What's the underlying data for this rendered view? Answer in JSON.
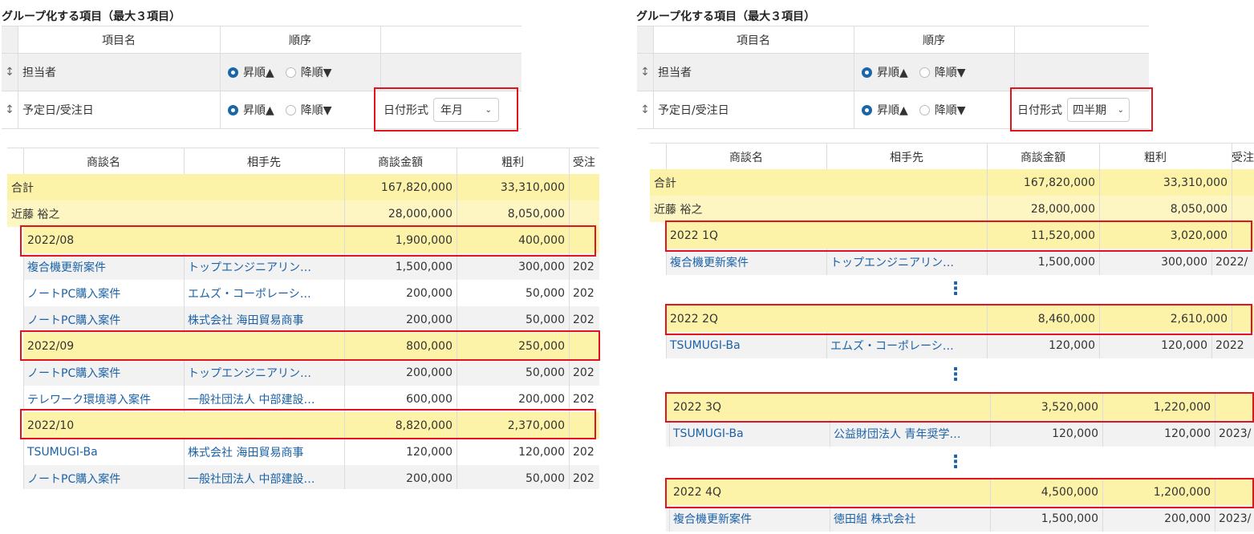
{
  "left": {
    "title": "グループ化する項目（最大３項目）",
    "cfg_headers": {
      "name": "項目名",
      "order": "順序"
    },
    "cfg_rows": [
      {
        "name": "担当者",
        "asc": "昇順▲",
        "desc": "降順▼"
      },
      {
        "name": "予定日/受注日",
        "asc": "昇順▲",
        "desc": "降順▼",
        "date_label": "日付形式",
        "date_value": "年月"
      }
    ],
    "grid_headers": [
      "商談名",
      "相手先",
      "商談金額",
      "粗利",
      "受注"
    ],
    "total": {
      "label": "合計",
      "amount": "167,820,000",
      "profit": "33,310,000"
    },
    "person": {
      "label": "近藤 裕之",
      "amount": "28,000,000",
      "profit": "8,050,000"
    },
    "groups": [
      {
        "label": "2022/08",
        "amount": "1,900,000",
        "profit": "400,000"
      },
      {
        "label": "2022/09",
        "amount": "800,000",
        "profit": "250,000"
      },
      {
        "label": "2022/10",
        "amount": "8,820,000",
        "profit": "2,370,000"
      }
    ],
    "rows": [
      {
        "name": "複合機更新案件",
        "partner": "トップエンジニアリン…",
        "amount": "1,500,000",
        "profit": "300,000",
        "date": "202"
      },
      {
        "name": "ノートPC購入案件",
        "partner": "エムズ・コーポレーシ…",
        "amount": "200,000",
        "profit": "50,000",
        "date": "202"
      },
      {
        "name": "ノートPC購入案件",
        "partner": "株式会社 海田貿易商事",
        "amount": "200,000",
        "profit": "50,000",
        "date": "202"
      },
      {
        "name": "ノートPC購入案件",
        "partner": "トップエンジニアリン…",
        "amount": "200,000",
        "profit": "50,000",
        "date": "202"
      },
      {
        "name": "テレワーク環境導入案件",
        "partner": "一般社団法人 中部建設…",
        "amount": "600,000",
        "profit": "200,000",
        "date": "202"
      },
      {
        "name": "TSUMUGI-Ba",
        "partner": "株式会社 海田貿易商事",
        "amount": "120,000",
        "profit": "120,000",
        "date": "202"
      },
      {
        "name": "ノートPC購入案件",
        "partner": "一般社団法人 中部建設…",
        "amount": "200,000",
        "profit": "50,000",
        "date": "202"
      }
    ]
  },
  "right": {
    "title": "グループ化する項目（最大３項目）",
    "cfg_headers": {
      "name": "項目名",
      "order": "順序"
    },
    "cfg_rows": [
      {
        "name": "担当者",
        "asc": "昇順▲",
        "desc": "降順▼"
      },
      {
        "name": "予定日/受注日",
        "asc": "昇順▲",
        "desc": "降順▼",
        "date_label": "日付形式",
        "date_value": "四半期"
      }
    ],
    "grid_headers": [
      "商談名",
      "相手先",
      "商談金額",
      "粗利",
      "受注"
    ],
    "total": {
      "label": "合計",
      "amount": "167,820,000",
      "profit": "33,310,000"
    },
    "person": {
      "label": "近藤 裕之",
      "amount": "28,000,000",
      "profit": "8,050,000"
    },
    "groups": [
      {
        "label": "2022 1Q",
        "amount": "11,520,000",
        "profit": "3,020,000"
      },
      {
        "label": "2022 2Q",
        "amount": "8,460,000",
        "profit": "2,610,000"
      },
      {
        "label": "2022 3Q",
        "amount": "3,520,000",
        "profit": "1,220,000"
      },
      {
        "label": "2022 4Q",
        "amount": "4,500,000",
        "profit": "1,200,000"
      }
    ],
    "rows": [
      {
        "name": "複合機更新案件",
        "partner": "トップエンジニアリン…",
        "amount": "1,500,000",
        "profit": "300,000",
        "date": "2022/"
      },
      {
        "name": "TSUMUGI-Ba",
        "partner": "エムズ・コーポレーシ…",
        "amount": "120,000",
        "profit": "120,000",
        "date": "2022"
      },
      {
        "name": "TSUMUGI-Ba",
        "partner": "公益財団法人 青年奨学…",
        "amount": "120,000",
        "profit": "120,000",
        "date": "2023/"
      },
      {
        "name": "複合機更新案件",
        "partner": "徳田組 株式会社",
        "amount": "1,500,000",
        "profit": "200,000",
        "date": "2023/"
      }
    ]
  },
  "icons": {
    "drag_handle": "↕",
    "ellipsis": "⋮",
    "chevron": "⌄"
  }
}
